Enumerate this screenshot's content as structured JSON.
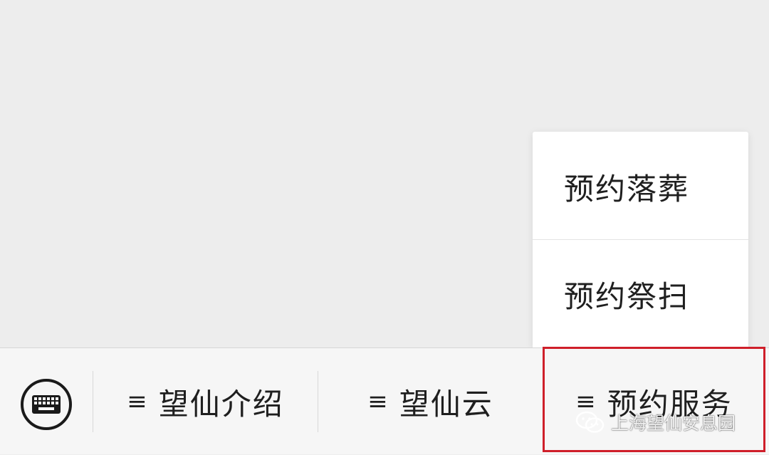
{
  "submenu": {
    "items": [
      {
        "label": "预约落葬"
      },
      {
        "label": "预约祭扫"
      }
    ]
  },
  "menubar": {
    "keyboard_icon": "keyboard-icon",
    "buttons": [
      {
        "label": "望仙介绍",
        "icon": "menu-lines-icon"
      },
      {
        "label": "望仙云",
        "icon": "menu-lines-icon"
      },
      {
        "label": "预约服务",
        "icon": "menu-lines-icon",
        "highlighted": true
      }
    ]
  },
  "watermark": {
    "text": "上海望仙安息园",
    "icon": "wechat-icon"
  },
  "colors": {
    "background": "#ededed",
    "menubar": "#f6f6f6",
    "highlight_border": "#cf1f2a"
  }
}
